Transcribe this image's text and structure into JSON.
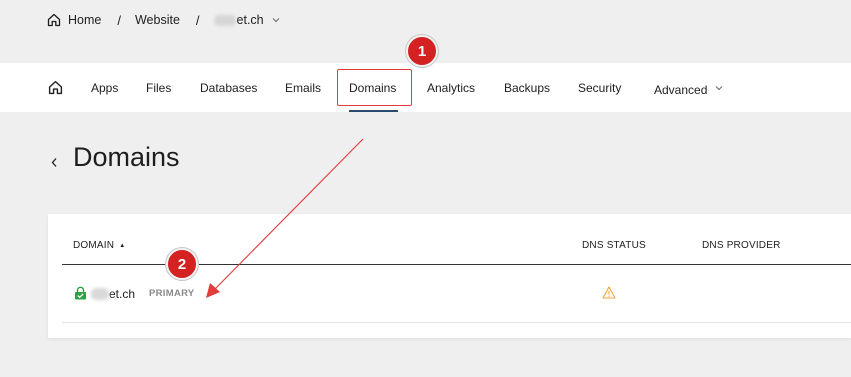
{
  "breadcrumb": {
    "home": "Home",
    "website": "Website",
    "site_suffix": "et.ch"
  },
  "nav": {
    "items": [
      "Apps",
      "Files",
      "Databases",
      "Emails",
      "Domains",
      "Analytics",
      "Backups",
      "Security",
      "Advanced"
    ],
    "active": "Domains"
  },
  "page": {
    "title": "Domains"
  },
  "table": {
    "columns": [
      "DOMAIN",
      "DNS STATUS",
      "DNS PROVIDER"
    ],
    "sort_column": "DOMAIN",
    "rows": [
      {
        "domain_suffix": "et.ch",
        "badge": "PRIMARY",
        "dns_status": "warning-icon",
        "dns_provider": ""
      }
    ]
  },
  "annotations": {
    "step1": "1",
    "step2": "2",
    "color": "#d42121"
  },
  "icons": [
    "home-icon",
    "chevron-down-icon",
    "back-arrow-icon",
    "lock-icon",
    "warning-icon",
    "sort-asc-icon"
  ]
}
